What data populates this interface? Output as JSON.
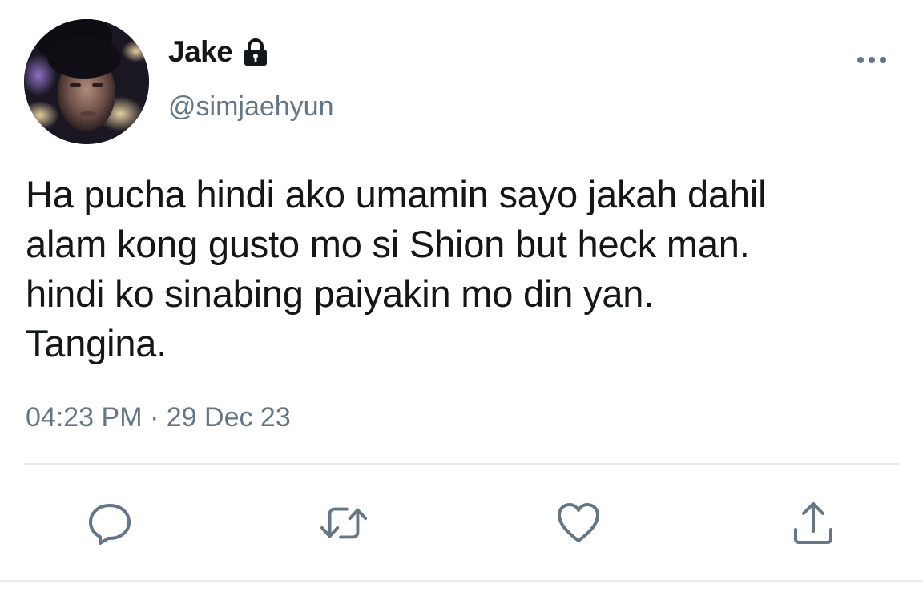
{
  "user": {
    "display_name": "Jake",
    "handle": "@simjaehyun",
    "lock_icon": "lock-icon",
    "avatar": "avatar"
  },
  "tweet": {
    "lines": [
      "Ha pucha hindi ako umamin sayo jakah dahil",
      "alam kong gusto mo si Shion but heck man.",
      "hindi ko sinabing paiyakin mo din yan.",
      "Tangina."
    ],
    "timestamp": "04:23 PM · 29 Dec 23"
  },
  "actions": {
    "more": "more-options-icon",
    "reply": "reply-icon",
    "retweet": "retweet-icon",
    "like": "like-icon",
    "share": "share-icon"
  },
  "colors": {
    "text": "#14171a",
    "secondary": "#657786",
    "icon": "#657786",
    "divider": "#e6ecf0"
  }
}
